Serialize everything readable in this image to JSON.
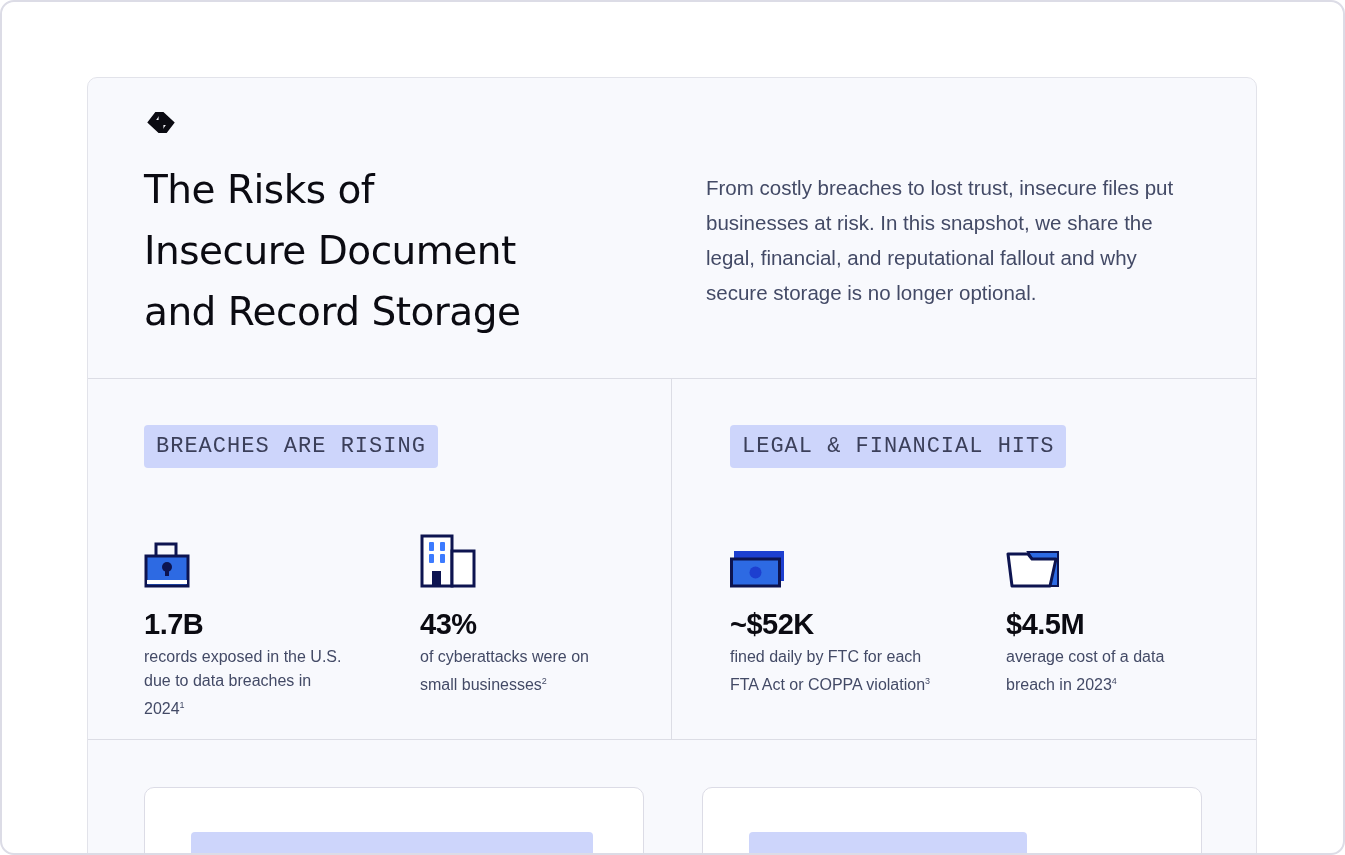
{
  "header": {
    "title_lines": [
      "The Risks of",
      "Insecure Document",
      "and Record Storage"
    ],
    "intro": "From costly breaches to lost trust, insecure files put businesses at risk. In this snapshot, we share the legal, financial, and reputational fallout and why secure storage is no longer optional."
  },
  "sections": [
    {
      "tag": "BREACHES ARE RISING",
      "stats": [
        {
          "kind": "lock",
          "value": "1.7B",
          "caption": "records exposed in the U.S. due to data breaches in 2024$^{1}$"
        },
        {
          "kind": "building",
          "value": "43%",
          "caption": "of cyberattacks were on small businesses$^{2}$"
        }
      ]
    },
    {
      "tag": "LEGAL & FINANCIAL HITS",
      "stats": [
        {
          "kind": "money",
          "value": "~$52K",
          "caption": "fined daily by FTC for each FTA Act or COPPA violation$^{3}$"
        },
        {
          "kind": "folder",
          "value": "$4.5M",
          "caption": "average cost of a data breach in 2023$^{4}$"
        }
      ]
    }
  ],
  "cards": [
    {
      "kind": "tagged"
    },
    {
      "kind": "tagged"
    }
  ]
}
